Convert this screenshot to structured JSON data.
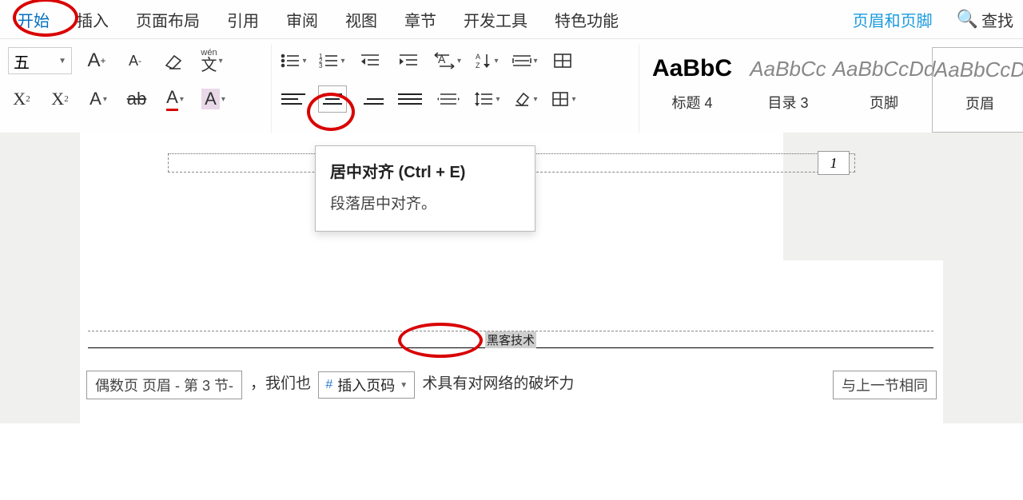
{
  "tabs": {
    "start": "开始",
    "insert": "插入",
    "layout": "页面布局",
    "references": "引用",
    "review": "审阅",
    "view": "视图",
    "sections": "章节",
    "dev": "开发工具",
    "special": "特色功能",
    "header_footer": "页眉和页脚",
    "search": "查找"
  },
  "font": {
    "size_value": "五",
    "grow_label": "A⁺",
    "shrink_label": "A⁻",
    "pinyin_rt": "wén",
    "pinyin_base": "文",
    "x2_sup": "X²",
    "x2_sub": "X₂"
  },
  "tooltip": {
    "title": "居中对齐  (Ctrl + E)",
    "body": "段落居中对齐。"
  },
  "styles": {
    "items": [
      {
        "preview": "AaBbC",
        "label": "标题 4",
        "bold": true
      },
      {
        "preview": "AaBbCc",
        "label": "目录 3",
        "bold": false
      },
      {
        "preview": "AaBbCcDd",
        "label": "页脚",
        "bold": false
      },
      {
        "preview": "AaBbCcD",
        "label": "页眉",
        "bold": false
      }
    ]
  },
  "doc": {
    "page_number": "1",
    "header_text": "黑客技术",
    "even_tag": "偶数页 页眉  - 第 3 节-",
    "body_left": "，我们也",
    "insert_pn_label": "插入页码",
    "body_right": "术具有对网络的破坏力",
    "same_prev": "与上一节相同"
  }
}
